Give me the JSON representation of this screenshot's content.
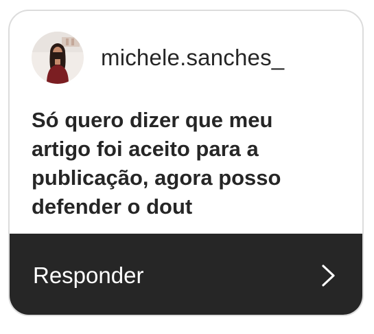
{
  "story_reply": {
    "username": "michele.sanches_",
    "avatar_icon": "profile-photo",
    "message": "Só quero dizer que meu artigo foi aceito para a publicação, agora posso defender o dout",
    "reply_label": "Responder",
    "reply_icon": "chevron-right-icon"
  },
  "colors": {
    "text": "#262626",
    "reply_bar": "#262626",
    "reply_text": "#ffffff",
    "card_border": "#dcdcdc"
  }
}
